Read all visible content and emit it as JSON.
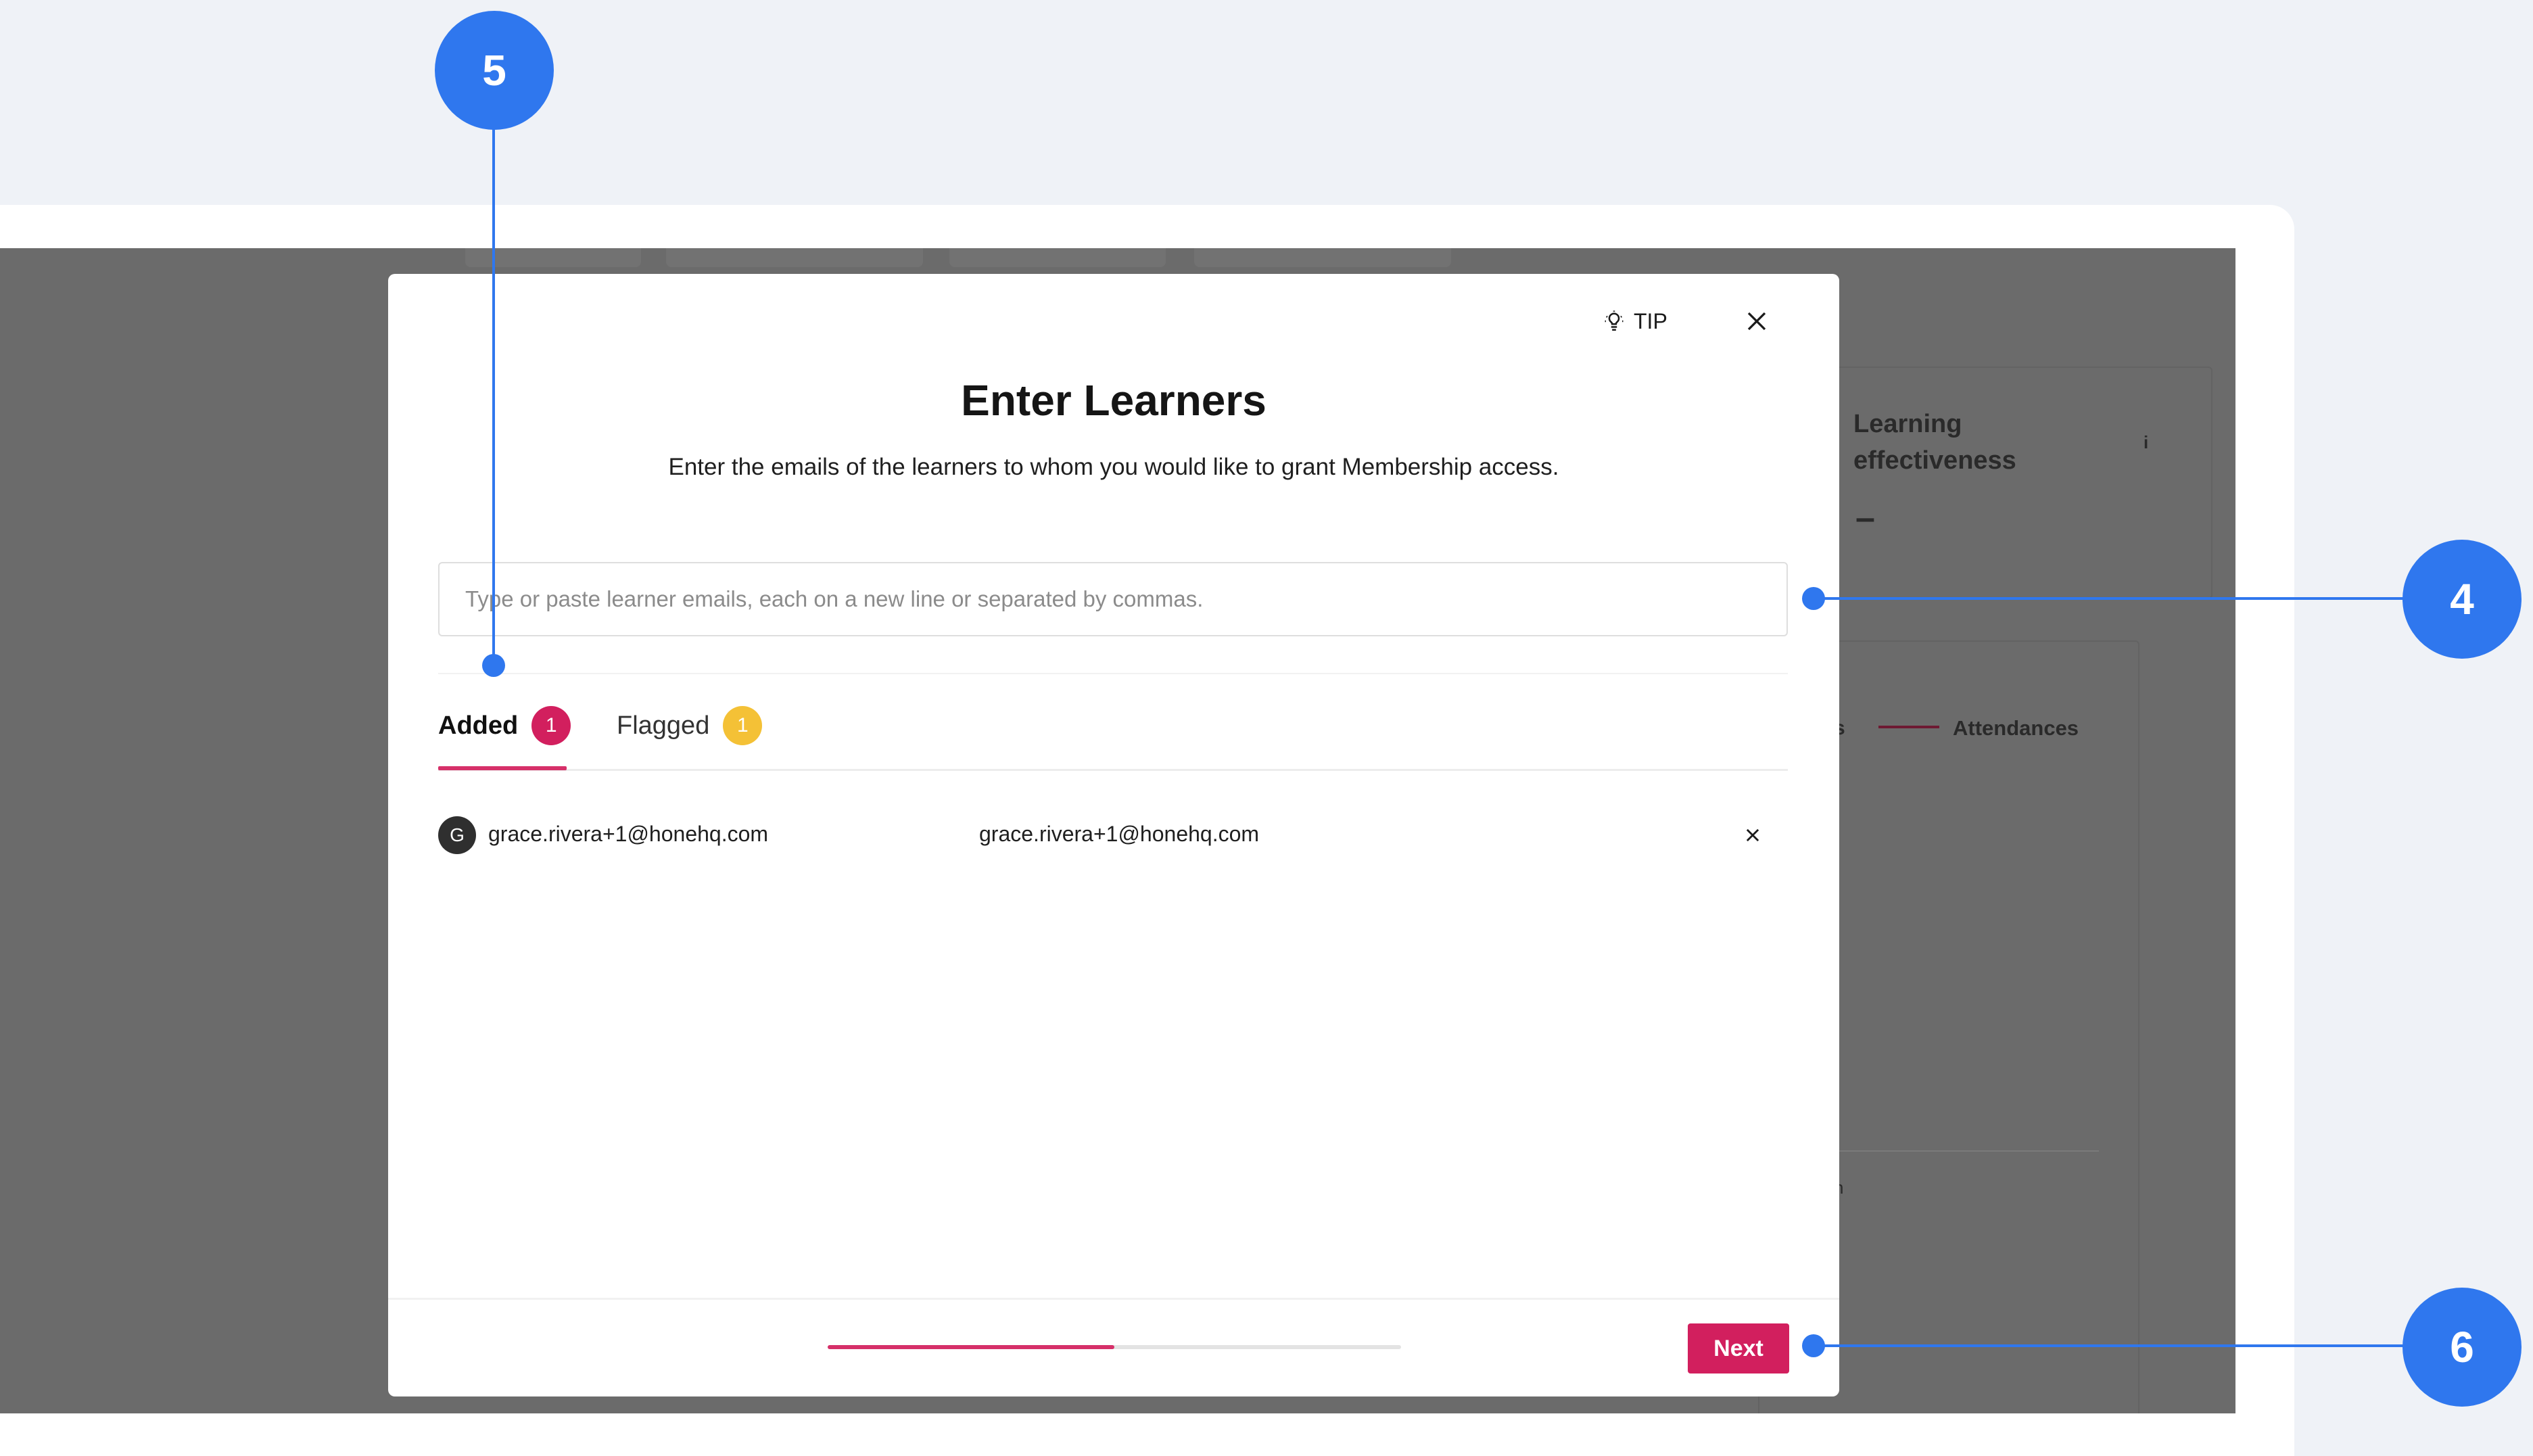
{
  "modal": {
    "tip_label": "TIP",
    "title": "Enter Learners",
    "subtitle": "Enter the emails of the learners to whom you would like to grant Membership access.",
    "email_placeholder": "Type or paste learner emails, each on a new line or separated by commas.",
    "tabs": [
      {
        "label": "Added",
        "count": "1",
        "color": "#d21f5e"
      },
      {
        "label": "Flagged",
        "count": "1",
        "color": "#f4c136"
      }
    ],
    "rows": [
      {
        "avatar": "G",
        "email": "grace.rivera+1@honehq.com",
        "name": "grace.rivera+1@honehq.com"
      }
    ],
    "progress_fraction": 0.5,
    "next_label": "Next"
  },
  "background": {
    "card_title": "Learning effectiveness",
    "card_value": "–",
    "info_glyph": "i",
    "legend_label": "Attendances",
    "legend_fragment": "s",
    "footnote_fragment": "n"
  },
  "annotations": [
    "5",
    "4",
    "6"
  ],
  "colors": {
    "accent": "#d21f5e",
    "annotation": "#2f77ee",
    "flag": "#f4c136"
  }
}
